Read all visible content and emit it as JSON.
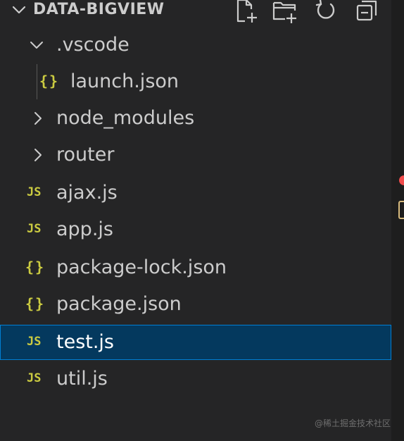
{
  "explorer": {
    "title": "DATA-BIGVIEW",
    "actions": [
      {
        "icon": "new-file-icon"
      },
      {
        "icon": "new-folder-icon"
      },
      {
        "icon": "refresh-icon"
      },
      {
        "icon": "collapse-all-icon"
      }
    ]
  },
  "tree": [
    {
      "label": ".vscode",
      "type": "folder",
      "expanded": true
    },
    {
      "label": "launch.json",
      "type": "json",
      "icon_text": "{}"
    },
    {
      "label": "node_modules",
      "type": "folder",
      "expanded": false
    },
    {
      "label": "router",
      "type": "folder",
      "expanded": false
    },
    {
      "label": "ajax.js",
      "type": "js",
      "icon_text": "JS"
    },
    {
      "label": "app.js",
      "type": "js",
      "icon_text": "JS"
    },
    {
      "label": "package-lock.json",
      "type": "json",
      "icon_text": "{}"
    },
    {
      "label": "package.json",
      "type": "json",
      "icon_text": "{}"
    },
    {
      "label": "test.js",
      "type": "js",
      "icon_text": "JS",
      "selected": true
    },
    {
      "label": "util.js",
      "type": "js",
      "icon_text": "JS"
    }
  ],
  "watermark": "@稀土掘金技术社区",
  "colors": {
    "background": "#252526",
    "selection": "#04395e",
    "selection_border": "#007fd4",
    "js_icon": "#cbcb41",
    "json_icon": "#cbcb41",
    "error_dot": "#f14c4c"
  }
}
